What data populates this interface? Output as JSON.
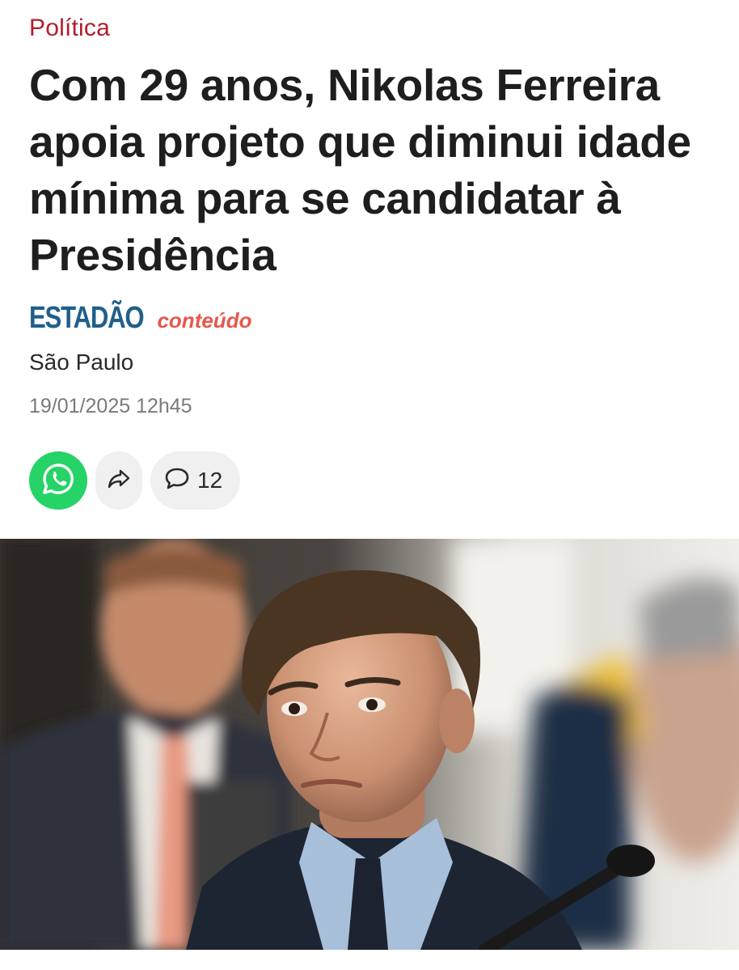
{
  "article": {
    "category": "Política",
    "headline": "Com 29 anos, Nikolas Ferreira apoia projeto que diminui idade mínima para se candidatar à Presidência",
    "source": {
      "name": "ESTADÃO",
      "tag": "conteúdo"
    },
    "location": "São Paulo",
    "timestamp": "19/01/2025 12h45"
  },
  "actions": {
    "whatsapp_icon": "whatsapp-icon",
    "share_icon": "share-arrow-icon",
    "comment_icon": "speech-bubble-icon",
    "comment_count": "12"
  },
  "colors": {
    "category": "#b31d2c",
    "source_name": "#1f5f8c",
    "source_tag": "#e8574c",
    "whatsapp": "#25d366",
    "action_bg": "#f0f0f0"
  }
}
